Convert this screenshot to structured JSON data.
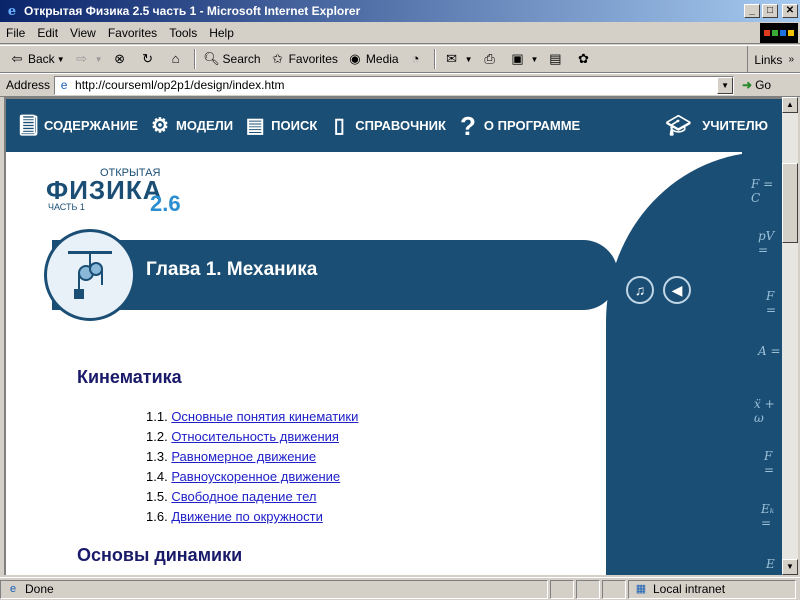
{
  "window": {
    "title": "Открытая Физика 2.5 часть 1 - Microsoft Internet Explorer",
    "minimize": "_",
    "maximize": "□",
    "close": "✕"
  },
  "menu": [
    "File",
    "Edit",
    "View",
    "Favorites",
    "Tools",
    "Help"
  ],
  "toolbar": {
    "back": "Back",
    "search": "Search",
    "favorites": "Favorites",
    "media": "Media",
    "links": "Links"
  },
  "address": {
    "label": "Address",
    "url": "http://courseml/op2p1/design/index.htm",
    "go": "Go"
  },
  "nav": {
    "contents": "СОДЕРЖАНИЕ",
    "models": "МОДЕЛИ",
    "search": "ПОИСК",
    "reference": "СПРАВОЧНИК",
    "about": "О ПРОГРАММЕ",
    "teacher": "УЧИТЕЛЮ"
  },
  "logo": {
    "top": "ОТКРЫТАЯ",
    "main": "ФИЗИКА",
    "version": "2.6",
    "part": "ЧАСТЬ 1"
  },
  "chapter": {
    "title": "Глава 1. Механика"
  },
  "sections": [
    {
      "heading": "Кинематика",
      "items": [
        {
          "num": "1.1.",
          "label": "Основные понятия кинематики"
        },
        {
          "num": "1.2.",
          "label": "Относительность движения"
        },
        {
          "num": "1.3.",
          "label": "Равномерное движение"
        },
        {
          "num": "1.4.",
          "label": "Равноускоренное движение"
        },
        {
          "num": "1.5.",
          "label": "Свободное падение тел"
        },
        {
          "num": "1.6.",
          "label": "Движение по окружности"
        }
      ]
    },
    {
      "heading": "Основы динамики",
      "items": []
    }
  ],
  "formulas": [
    "F = C",
    "pV =",
    "F =",
    "A =",
    "ẍ + ω",
    "F =",
    "Eₖ =",
    "E ="
  ],
  "status": {
    "text": "Done",
    "zone": "Local intranet"
  },
  "colors": {
    "navy": "#1a4e74",
    "link": "#2020c8",
    "heading": "#1a1a6a"
  }
}
